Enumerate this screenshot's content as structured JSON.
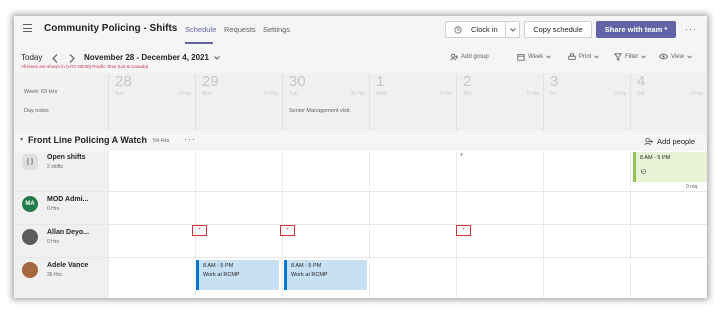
{
  "header": {
    "title": "Community Policing - Shifts",
    "tabs": [
      {
        "label": "Schedule"
      },
      {
        "label": "Requests"
      },
      {
        "label": "Settings"
      }
    ],
    "clock_in_label": "Clock in",
    "copy_schedule_label": "Copy schedule",
    "share_label": "Share with team *"
  },
  "toolbar": {
    "today_label": "Today",
    "date_range": "November 28 - December 4, 2021",
    "timezone_note": "All times are shown in (UTC-08:00) Pacific Time (US & Canada)",
    "add_group_label": "Add group",
    "week_label": "Week",
    "print_label": "Print",
    "filter_label": "Filter",
    "view_label": "View"
  },
  "days_header": {
    "week_label": "Week: 63 Hrs",
    "day_notes_label": "Day notes",
    "days": [
      {
        "num": "28",
        "name": "Sun",
        "hrs": "0 Hrs"
      },
      {
        "num": "29",
        "name": "Mon",
        "hrs": "27 Hrs"
      },
      {
        "num": "30",
        "name": "Tue",
        "hrs": "36 Hrs"
      },
      {
        "num": "1",
        "name": "Wed",
        "hrs": "0 Hrs"
      },
      {
        "num": "2",
        "name": "Thu",
        "hrs": "0 Hrs"
      },
      {
        "num": "3",
        "name": "Fri",
        "hrs": "0 Hrs"
      },
      {
        "num": "4",
        "name": "Sat",
        "hrs": "0 Hrs"
      }
    ],
    "tue_note": "Senior Management visit."
  },
  "group": {
    "name": "Front Line Policing A Watch",
    "hours": "54 Hrs",
    "add_people_label": "Add people"
  },
  "rows": [
    {
      "name": "Open shifts",
      "sub": "2 shifts"
    },
    {
      "name": "MOD Admi...",
      "sub": "0 Hrs",
      "initials": "MA"
    },
    {
      "name": "Allan Deyo...",
      "sub": "0 Hrs"
    },
    {
      "name": "Adele Vance",
      "sub": "36 Hrs"
    }
  ],
  "open_shift": {
    "time": "8 AM - 5 PM",
    "requests": "0 req"
  },
  "shifts": [
    {
      "time": "8 AM - 5 PM",
      "label": "Work at RCMP"
    },
    {
      "time": "8 AM - 5 PM",
      "label": "Work at RCMP"
    }
  ],
  "markers": {
    "symbol": "*"
  },
  "icons": [
    "hamburger-icon",
    "chevron-left-icon",
    "chevron-right-icon",
    "clock-icon",
    "calendar-icon",
    "printer-icon",
    "filter-icon",
    "eye-icon",
    "add-people-icon",
    "open-shift-icon"
  ],
  "colors": {
    "accent": "#6264a7",
    "shift_fill": "#c7e0f4",
    "shift_border": "#0078d4",
    "open_fill": "#e7f2d5",
    "open_border": "#92c353",
    "marker": "#d13438",
    "avatar_ma": "#237b4b"
  }
}
